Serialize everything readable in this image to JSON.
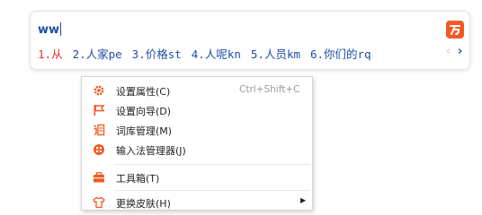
{
  "ime": {
    "composition": "ww",
    "candidates": [
      {
        "label": "1.从"
      },
      {
        "label": "2.人家pe"
      },
      {
        "label": "3.价格st"
      },
      {
        "label": "4.人呢kn"
      },
      {
        "label": "5.人员km"
      },
      {
        "label": "6.你们的rq"
      }
    ],
    "prev_glyph": "‹",
    "next_glyph": "›",
    "colors": {
      "text": "#1f4fa3",
      "selected": "#e8322b",
      "logo": "#f15a24"
    }
  },
  "menu": {
    "items": [
      {
        "label": "设置属性(C)",
        "shortcut": "Ctrl+Shift+C",
        "icon": "gear-icon"
      },
      {
        "label": "设置向导(D)",
        "icon": "flag-icon"
      },
      {
        "label": "词库管理(M)",
        "icon": "dictionary-icon"
      },
      {
        "label": "输入法管理器(J)",
        "icon": "manager-icon"
      },
      {
        "label": "工具箱(T)",
        "icon": "toolbox-icon"
      },
      {
        "label": "更换皮肤(H)",
        "icon": "skin-icon",
        "submenu_glyph": "▶"
      }
    ],
    "icon_color": "#f15a24"
  }
}
